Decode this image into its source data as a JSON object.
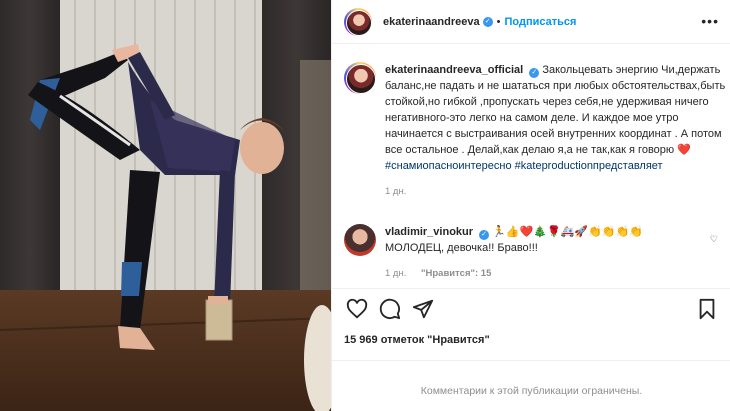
{
  "header": {
    "username": "ekaterinaandreeva",
    "separator": "•",
    "follow_label": "Подписаться",
    "more_label": "•••"
  },
  "caption": {
    "username": "ekaterinaandreeva_official",
    "text": "Закольцевать энергию Чи,держать баланс,не падать и не шататься при любых обстоятельствах,быть стойкой,но гибкой ,пропускать через себя,не удерживая ничего негативного-это легко на самом деле. И каждое мое утро начинается с выстраивания осей внутренних координат . А потом все остальное . Делай,как делаю я,а не так,как я говорю",
    "emoji": "❤️",
    "hashtag1": "#снамиопасноинтересно",
    "hashtag2": "#kateproductionпредставляет",
    "time": "1 дн."
  },
  "reply": {
    "username": "vladimir_vinokur",
    "emojis": "🏃👍❤️🎄🌹🚑🚀👏👏👏👏",
    "text": "МОЛОДЕЦ, девочка!! Браво!!!",
    "time": "1 дн.",
    "likes_label": "\"Нравится\": 15"
  },
  "likes": "15 969 отметок \"Нравится\"",
  "comments_closed": "Комментарии к этой публикации ограничены.",
  "icons": [
    "heart-icon",
    "comment-icon",
    "share-icon",
    "bookmark-icon",
    "more-icon",
    "verified-icon"
  ],
  "colors": {
    "accent": "#0095f6",
    "verified": "#3897f0",
    "muted": "#8e8e8e",
    "hashtag": "#00376b"
  }
}
